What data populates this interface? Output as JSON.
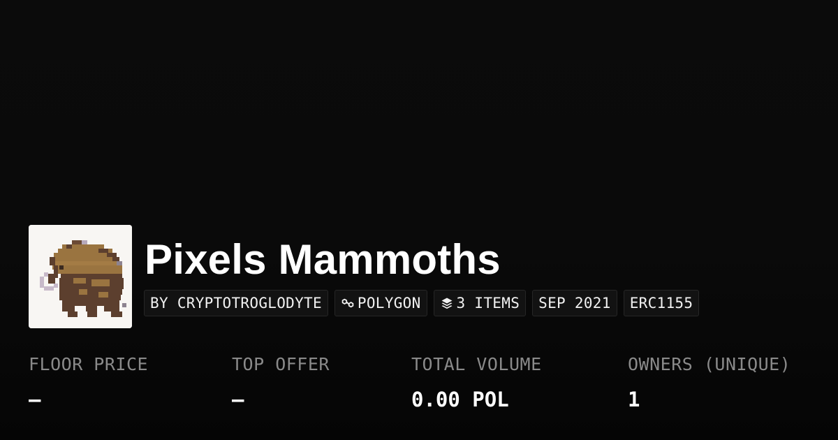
{
  "collection": {
    "title": "Pixels Mammoths",
    "avatar_icon": "pixel-mammoth-image",
    "badges": [
      {
        "label": "BY CRYPTOTROGLODYTE",
        "icon": null
      },
      {
        "label": "POLYGON",
        "icon": "polygon-chain-icon"
      },
      {
        "label": "3 ITEMS",
        "icon": "layers-icon"
      },
      {
        "label": "SEP 2021",
        "icon": null
      },
      {
        "label": "ERC1155",
        "icon": null
      }
    ]
  },
  "stats": [
    {
      "label": "FLOOR PRICE",
      "value": "–"
    },
    {
      "label": "TOP OFFER",
      "value": "–"
    },
    {
      "label": "TOTAL VOLUME",
      "value": "0.00 POL"
    },
    {
      "label": "OWNERS (UNIQUE)",
      "value": "1"
    }
  ],
  "colors": {
    "background": "#0a0a0a",
    "badge_background": "#121212",
    "label_gray": "#8a8a8a",
    "text": "#ffffff",
    "mammoth_fur_light": "#9a7440",
    "mammoth_fur_dark": "#5c3f2e"
  }
}
